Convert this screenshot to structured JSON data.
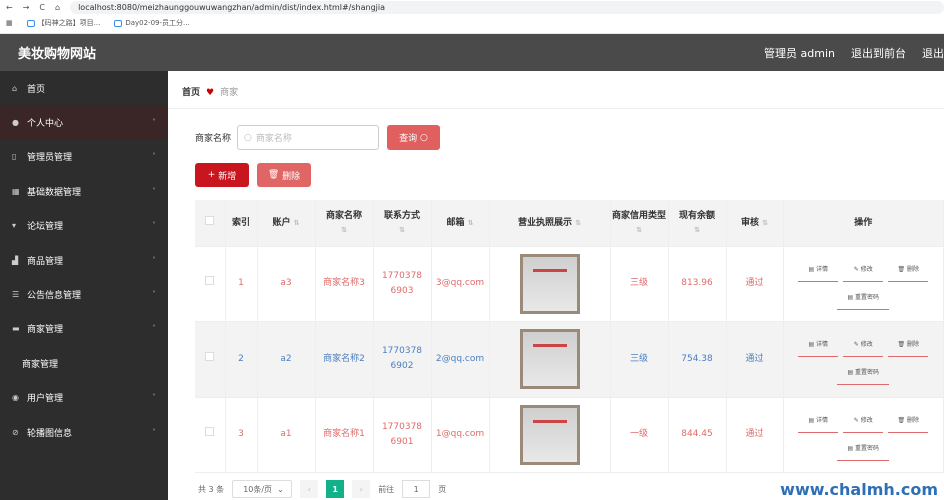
{
  "browser": {
    "url": "localhost:8080/meizhaunggouwuwangzhan/admin/dist/index.html#/shangjia",
    "bookmarks": [
      "【码神之路】项目...",
      "Day02-09-员工分..."
    ]
  },
  "header": {
    "title": "美妆购物网站",
    "user": "管理员 admin",
    "front": "退出到前台",
    "logout": "退出"
  },
  "sidebar": {
    "items": [
      {
        "label": "首页",
        "icon": "home-icon",
        "chev": false
      },
      {
        "label": "个人中心",
        "icon": "user-icon",
        "chev": true
      },
      {
        "label": "管理员管理",
        "icon": "phone-icon",
        "chev": true
      },
      {
        "label": "基础数据管理",
        "icon": "grid-icon",
        "chev": true
      },
      {
        "label": "论坛管理",
        "icon": "forum-icon",
        "chev": true
      },
      {
        "label": "商品管理",
        "icon": "chart-icon",
        "chev": true
      },
      {
        "label": "公告信息管理",
        "icon": "notice-icon",
        "chev": true
      },
      {
        "label": "商家管理",
        "icon": "shop-icon",
        "chev": true
      },
      {
        "label": "商家管理",
        "sub": true
      },
      {
        "label": "用户管理",
        "icon": "location-icon",
        "chev": true
      },
      {
        "label": "轮播图信息",
        "icon": "link-icon",
        "chev": true
      }
    ]
  },
  "breadcrumb": {
    "home": "首页",
    "current": "商家"
  },
  "search": {
    "label": "商家名称",
    "placeholder": "商家名称",
    "button": "查询"
  },
  "actions": {
    "add": "新增",
    "delete": "删除"
  },
  "table": {
    "headers": [
      "索引",
      "账户",
      "商家名称",
      "联系方式",
      "邮箱",
      "营业执照展示",
      "商家信用类型",
      "现有余额",
      "审核",
      "操作"
    ],
    "rows": [
      {
        "index": "1",
        "account": "a3",
        "name": "商家名称3",
        "phone": "17703786903",
        "email": "3@qq.com",
        "credit": "三级",
        "balance": "813.96",
        "audit": "通过"
      },
      {
        "index": "2",
        "account": "a2",
        "name": "商家名称2",
        "phone": "17703786902",
        "email": "2@qq.com",
        "credit": "三级",
        "balance": "754.38",
        "audit": "通过"
      },
      {
        "index": "3",
        "account": "a1",
        "name": "商家名称1",
        "phone": "17703786901",
        "email": "1@qq.com",
        "credit": "一级",
        "balance": "844.45",
        "audit": "通过"
      }
    ],
    "ops": {
      "detail": "详情",
      "edit": "修改",
      "delete": "删除",
      "reset": "重置密码"
    }
  },
  "pagination": {
    "total": "共 3 条",
    "page_size": "10条/页",
    "current": "1",
    "goto": "前往",
    "goto_value": "1",
    "page_unit": "页"
  },
  "watermark": "www.chalmh.com"
}
